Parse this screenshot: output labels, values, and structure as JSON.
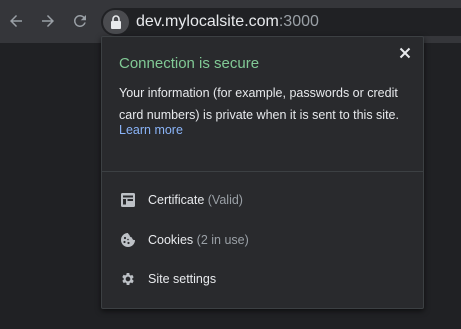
{
  "toolbar": {
    "url_host": "dev.mylocalsite.com",
    "url_port": ":3000"
  },
  "popup": {
    "title": "Connection is secure",
    "description": "Your information (for example, passwords or credit card numbers) is private when it is sent to this site.",
    "learn_more": "Learn more",
    "items": [
      {
        "label": "Certificate",
        "meta": "(Valid)",
        "icon": "certificate-icon"
      },
      {
        "label": "Cookies",
        "meta": "(2 in use)",
        "icon": "cookie-icon"
      },
      {
        "label": "Site settings",
        "meta": "",
        "icon": "gear-icon"
      }
    ]
  },
  "colors": {
    "secure_green": "#81c995",
    "link_blue": "#8ab4f8",
    "text": "#e8eaed",
    "muted": "#9aa0a6",
    "popup_bg": "#292a2d",
    "toolbar_bg": "#35363a"
  }
}
